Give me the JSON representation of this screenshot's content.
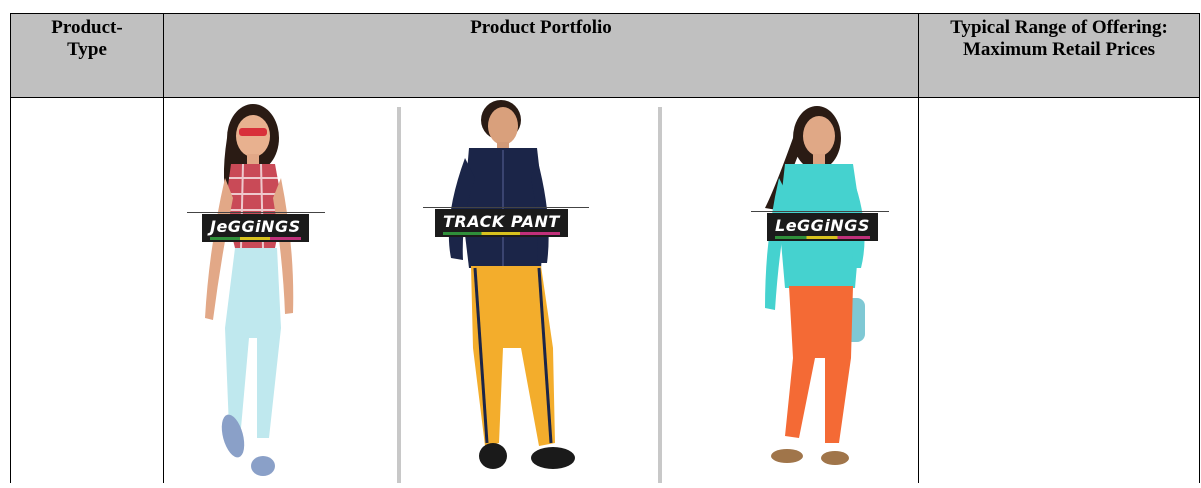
{
  "table": {
    "headers": {
      "product_type": "Product-\nType",
      "product_portfolio": "Product Portfolio",
      "typical_range": "Typical Range of Offering: Maximum Retail Prices"
    }
  },
  "products": [
    {
      "name": "jeggings",
      "label": "JeGGiNGS",
      "top_color": "#e05060",
      "bottom_color": "#bfe8ee",
      "shoe_color": "#8aa0c8"
    },
    {
      "name": "track-pant",
      "label": "TRACK PANT",
      "top_color": "#1b2548",
      "bottom_color": "#f3ad2c",
      "shoe_color": "#1a1a1a"
    },
    {
      "name": "leggings",
      "label": "LeGGiNGS",
      "top_color": "#45d2cf",
      "bottom_color": "#f46a35",
      "shoe_color": "#a0754a"
    }
  ]
}
